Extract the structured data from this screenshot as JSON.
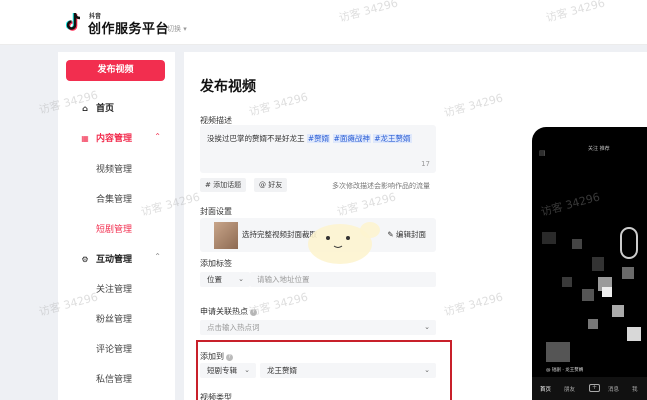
{
  "header": {
    "logo_small": "抖音",
    "logo_text": "创作服务平台",
    "user": "切换 ▾"
  },
  "sidebar": {
    "publish_button": "发布视频",
    "home": "首页",
    "content": "内容管理",
    "content_items": [
      "视频管理",
      "合集管理",
      "短剧管理"
    ],
    "interact": "互动管理",
    "interact_items": [
      "关注管理",
      "粉丝管理",
      "评论管理",
      "私信管理"
    ],
    "caret_up": "⌃",
    "caret_down": "⌄"
  },
  "main": {
    "page_title": "发布视频",
    "description": {
      "label": "视频描述",
      "text": "没挨过巴掌的赘婿不是好龙王",
      "tags": [
        "#赘婿",
        "#面瘫战神",
        "#龙王赘婿"
      ],
      "count": "17"
    },
    "add_topic": "# 添加话题",
    "mention": "@ 好友",
    "hint": "多次修改描述会影响作品的流量",
    "cover": {
      "label": "封面设置",
      "text": "选持完整视频封面裁取",
      "edit": "编辑封面"
    },
    "tags_section": {
      "label": "添加标签",
      "location": "位置",
      "placeholder": "请输入地址位置"
    },
    "hotspot": {
      "label": "申请关联热点",
      "placeholder": "点击输入热点词"
    },
    "add_to": {
      "label": "添加到",
      "type": "短剧专辑",
      "value": "龙王赘婿"
    },
    "next_label": "视频类型"
  },
  "phone": {
    "tabs": "关注  推荐",
    "nav": [
      "首页",
      "朋友",
      "+",
      "消息",
      "我"
    ],
    "caption": "@ 短剧 · 龙王赘婿"
  },
  "watermark": "访客 34296",
  "colors": {
    "accent": "#f22e4f",
    "highlight_box": "#c8202a",
    "tag": "#2c5fd6"
  }
}
